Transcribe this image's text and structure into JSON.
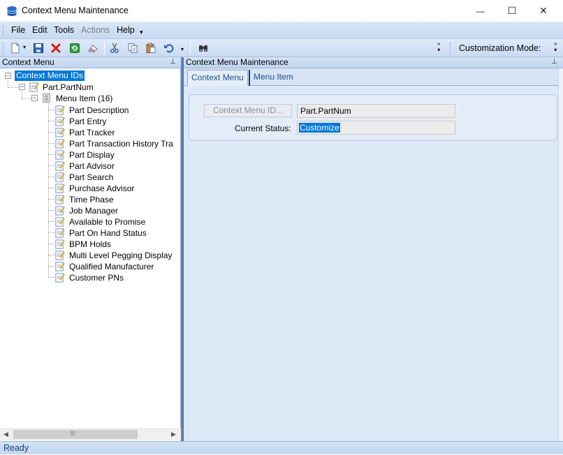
{
  "window": {
    "title": "Context Menu Maintenance",
    "minimize_glyph": "—",
    "maximize_glyph": "☐",
    "close_glyph": "✕"
  },
  "menubar": {
    "items": [
      "File",
      "Edit",
      "Tools",
      "Actions",
      "Help"
    ],
    "disabled": [
      "Actions"
    ]
  },
  "toolbar": {
    "customization_mode_label": "Customization Mode:",
    "icons": [
      "new-icon",
      "save-icon",
      "delete-icon",
      "refresh-icon",
      "clear-icon",
      "cut-icon",
      "copy-icon",
      "paste-icon",
      "undo-icon",
      "find-icon"
    ]
  },
  "left_panel": {
    "title": "Context Menu",
    "tree": {
      "root": "Context Menu IDs",
      "child": "Part.PartNum",
      "group": "Menu Item (16)",
      "items": [
        "Part Description",
        "Part Entry",
        "Part Tracker",
        "Part Transaction History Tra",
        "Part Display",
        "Part Advisor",
        "Part Search",
        "Purchase Advisor",
        "Time Phase",
        "Job Manager",
        "Available to Promise",
        "Part On Hand Status",
        "BPM Holds",
        "Multi Level Pegging Display",
        "Qualified Manufacturer",
        "Customer PNs"
      ]
    },
    "scroll_grip": "|||"
  },
  "right_panel": {
    "title": "Context Menu Maintenance",
    "tabs": [
      "Context Menu",
      "Menu Item"
    ],
    "context_menu_id_button": "Context Menu ID...",
    "context_menu_id_value": "Part.PartNum",
    "current_status_label": "Current Status:",
    "current_status_value": "Customize"
  },
  "statusbar": {
    "text": "Ready"
  },
  "colors": {
    "selection": "#0078d7",
    "accent": "#1e4e8c"
  }
}
